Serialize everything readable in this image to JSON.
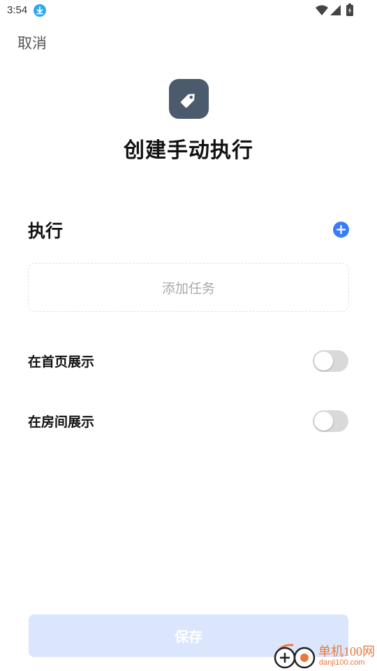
{
  "status_bar": {
    "time": "3:54",
    "icons": [
      "download-icon",
      "wifi-icon",
      "signal-icon",
      "battery-icon"
    ]
  },
  "header": {
    "cancel_label": "取消",
    "icon": "tag-icon",
    "title": "创建手动执行"
  },
  "execute_section": {
    "title": "执行",
    "add_icon": "plus-circle-icon",
    "add_task_label": "添加任务"
  },
  "settings": {
    "show_on_home": {
      "label": "在首页展示",
      "enabled": false
    },
    "show_in_room": {
      "label": "在房间展示",
      "enabled": false
    }
  },
  "footer": {
    "save_label": "保存"
  },
  "watermark": {
    "name": "单机100网",
    "url": "danji100.com"
  },
  "colors": {
    "accent": "#3b7cf6",
    "badge": "#4c5a6e",
    "save_disabled": "#dbe6fd",
    "toggle_off": "#d9d9d9",
    "watermark": "#e8793b"
  }
}
